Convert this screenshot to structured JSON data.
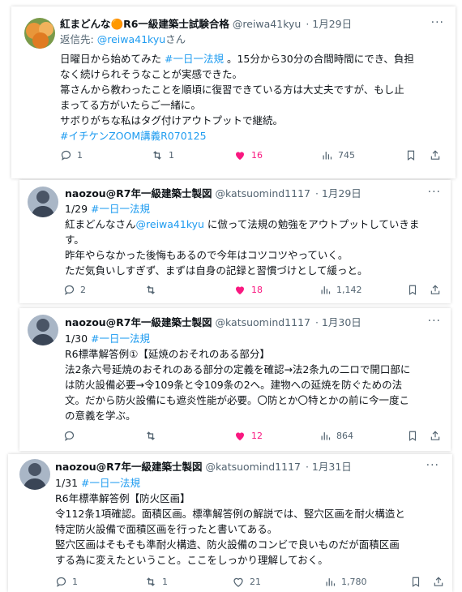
{
  "tweets": [
    {
      "name": "紅まどんな🟠R6一級建築士試験合格",
      "handle": "@reiwa41kyu",
      "date": "· 1月29日",
      "reply_label": "返信先:",
      "reply_handle": "@reiwa41kyu",
      "reply_suffix": "さん",
      "lines": [
        [
          "日曜日から始めてみた ",
          "#一日一法規",
          " 。15分から30分の合間時間にでき、負担"
        ],
        [
          "なく続けられそうなことが実感できた。"
        ],
        [
          "箒さんから教わったことを順頃に復習できている方は大丈夫ですが、もし止"
        ],
        [
          "まってる方がいたらご一緒に。"
        ],
        [
          "サボりがちな私はタグ付けアウトプットで継続。"
        ],
        [
          "#イチケンZOOM講義R070125"
        ]
      ],
      "replies": "1",
      "retweets": "1",
      "likes": "16",
      "views": "745",
      "avatar_colors": [
        "#e8963a",
        "#f2b25c",
        "#7a9a4a"
      ]
    },
    {
      "name": "naozou@R7年一級建築士製図",
      "handle": "@katsuomind1117",
      "date": "· 1月29日",
      "lines": [
        [
          "1/29 ",
          "#一日一法規"
        ],
        [
          "紅まどんなさん",
          "@reiwa41kyu",
          " に倣って法規の勉強をアウトプットしていきま"
        ],
        [
          "す。"
        ],
        [
          "昨年やらなかった後悔もあるので今年はコツコツやっていく。"
        ],
        [
          "ただ気負いしすぎず、まずは自身の記録と習慣づけとして緩っと。"
        ]
      ],
      "replies": "2",
      "retweets": "",
      "likes": "18",
      "views": "1,142"
    },
    {
      "name": "naozou@R7年一級建築士製図",
      "handle": "@katsuomind1117",
      "date": "· 1月30日",
      "lines": [
        [
          "1/30 ",
          "#一日一法規"
        ],
        [
          "R6標準解答例①【延焼のおそれのある部分】"
        ],
        [
          "法2条六号延焼のおそれのある部分の定義を確認→法2条九の二ロで開口部に"
        ],
        [
          "は防火設備必要→令109条と令109条の2へ。建物への延焼を防ぐための法"
        ],
        [
          "文。だから防火設備にも遮炎性能が必要。〇防とか〇特とかの前に今一度こ"
        ],
        [
          "の意義を学ぶ。"
        ]
      ],
      "replies": "",
      "retweets": "",
      "likes": "12",
      "views": "864"
    },
    {
      "name": "naozou@R7年一級建築士製図",
      "handle": "@katsuomind1117",
      "date": "· 1月31日",
      "lines": [
        [
          "1/31 ",
          "#一日一法規"
        ],
        [
          "R6年標準解答例【防火区画】"
        ],
        [
          "令112条1項確認。面積区画。標準解答例の解説では、竪穴区画を耐火構造と"
        ],
        [
          "特定防火設備で面積区画を行ったと書いてある。"
        ],
        [
          "竪穴区画はそもそも準耐火構造、防火設備のコンビで良いものだが面積区画"
        ],
        [
          "する為に変えたということ。ここをしっかり理解しておく。"
        ]
      ],
      "replies": "1",
      "retweets": "1",
      "likes": "21",
      "views": "1,780"
    }
  ]
}
